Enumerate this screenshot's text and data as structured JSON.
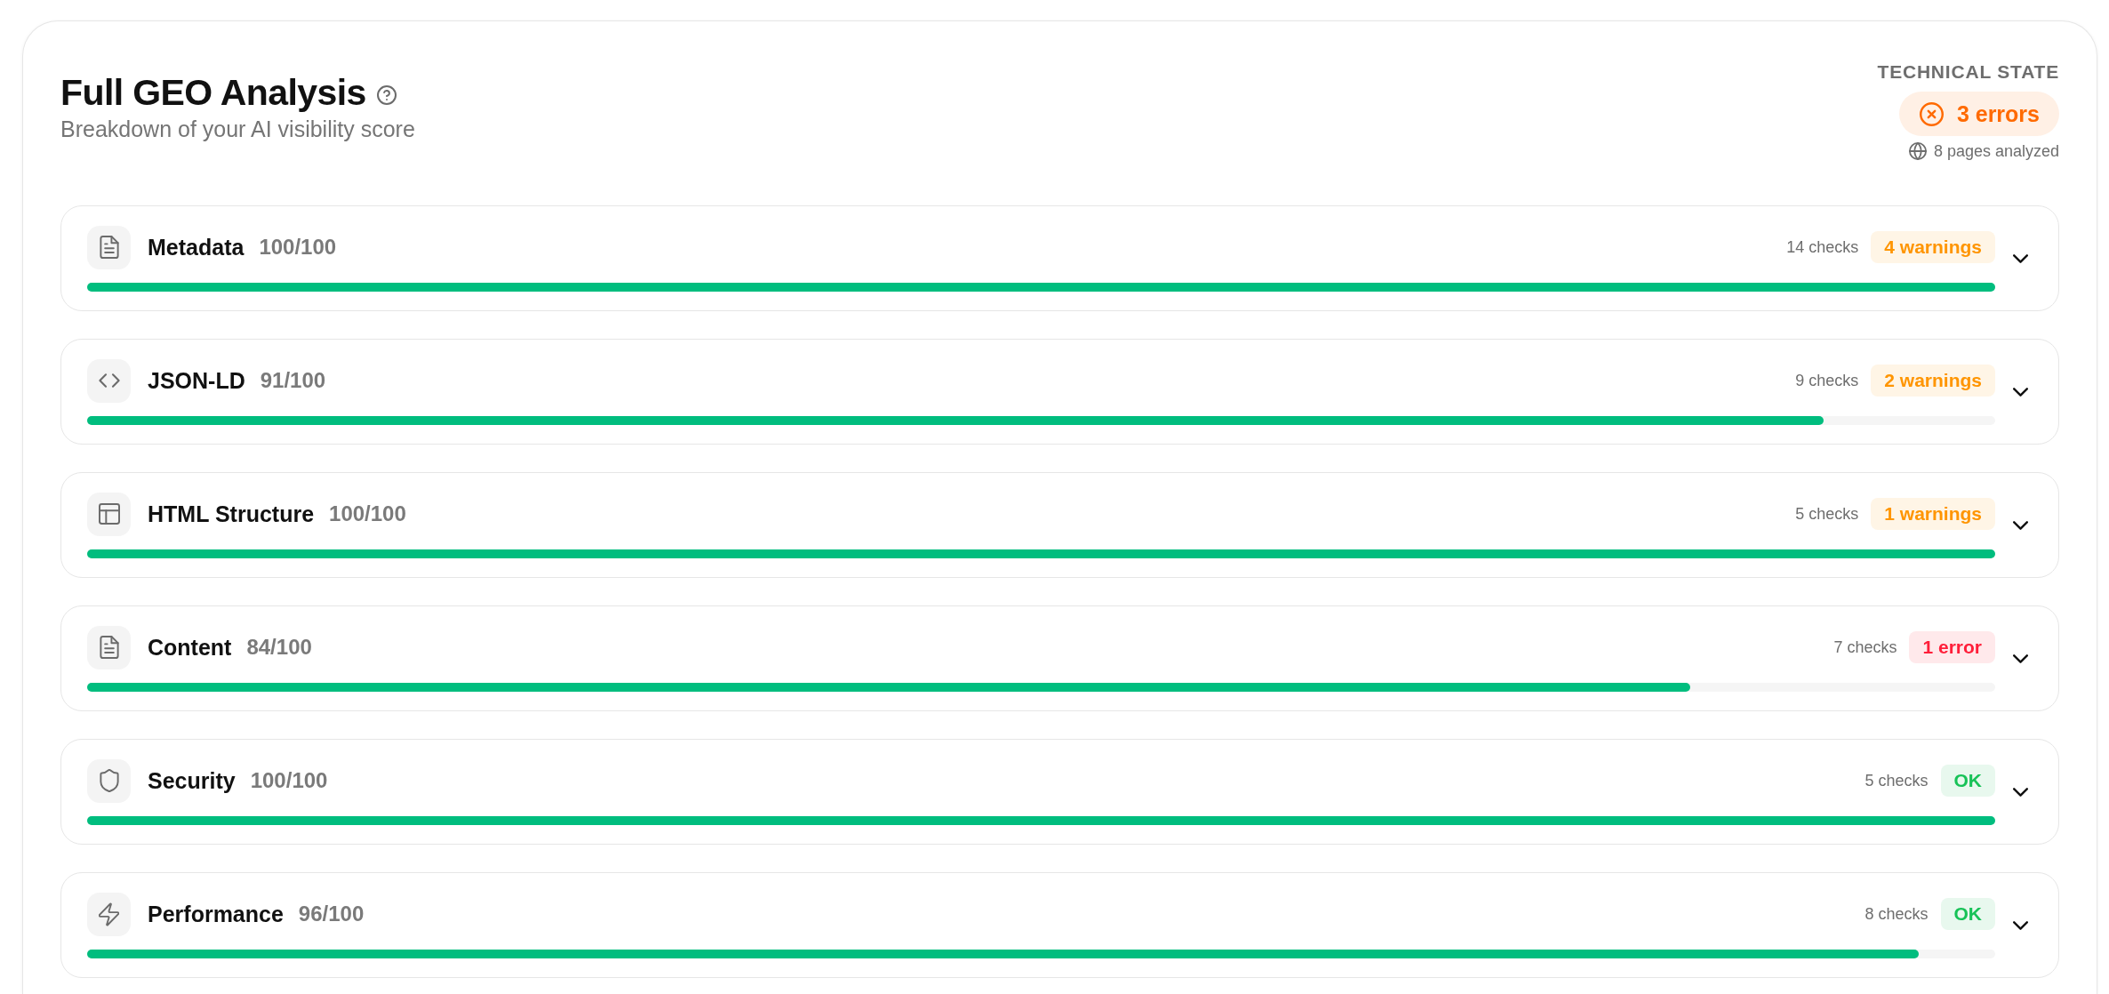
{
  "header": {
    "title": "Full GEO Analysis",
    "subtitle": "Breakdown of your AI visibility score"
  },
  "technical_state": {
    "label": "TECHNICAL STATE",
    "status": "3 errors",
    "pages": "8 pages analyzed"
  },
  "categories": [
    {
      "name": "Metadata",
      "score": "100/100",
      "level": 1,
      "checks": "14 checks",
      "badge": {
        "text": "4 warnings",
        "kind": "warning"
      },
      "expanded": false
    },
    {
      "name": "JSON-LD",
      "score": "91/100",
      "level": 0.91,
      "checks": "9 checks",
      "badge": {
        "text": "2 warnings",
        "kind": "warning"
      },
      "expanded": false
    },
    {
      "name": "HTML Structure",
      "score": "100/100",
      "level": 1,
      "checks": "5 checks",
      "badge": {
        "text": "1 warnings",
        "kind": "warning"
      },
      "expanded": false
    },
    {
      "name": "Content",
      "score": "84/100",
      "level": 0.84,
      "checks": "7 checks",
      "badge": {
        "text": "1 error",
        "kind": "error"
      },
      "expanded": false
    },
    {
      "name": "Security",
      "score": "100/100",
      "level": 1,
      "checks": "5 checks",
      "badge": {
        "text": "OK",
        "kind": "ok"
      },
      "expanded": false
    },
    {
      "name": "Performance",
      "score": "96/100",
      "level": 0.96,
      "checks": "8 checks",
      "badge": {
        "text": "OK",
        "kind": "ok"
      },
      "expanded": false
    }
  ]
}
